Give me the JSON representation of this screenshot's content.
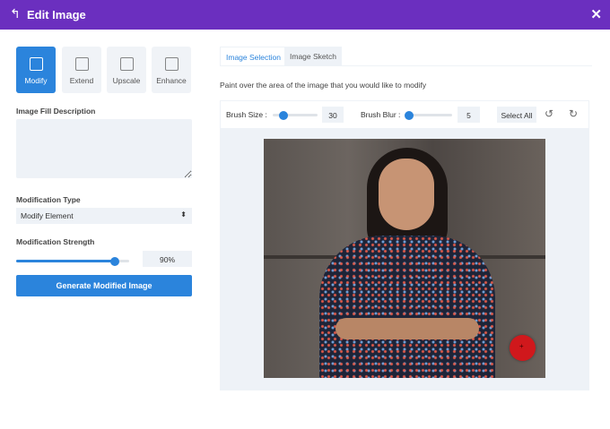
{
  "header": {
    "title": "Edit Image",
    "back_icon": "undo-arrow-icon",
    "close_icon": "close-icon"
  },
  "modes": [
    {
      "label": "Modify",
      "active": true
    },
    {
      "label": "Extend"
    },
    {
      "label": "Upscale"
    },
    {
      "label": "Enhance"
    }
  ],
  "fill_description": {
    "label": "Image Fill Description",
    "value": ""
  },
  "modification_type": {
    "label": "Modification Type",
    "value": "Modify Element"
  },
  "modification_strength": {
    "label": "Modification Strength",
    "value": "90%",
    "fraction": 0.9
  },
  "generate_label": "Generate Modified Image",
  "tabs": [
    {
      "label": "Image Selection",
      "active": true
    },
    {
      "label": "Image Sketch"
    }
  ],
  "instruction": "Paint over the area of the image that you would like to modify",
  "toolbar": {
    "brush_size_label": "Brush Size :",
    "brush_size": "30",
    "brush_blur_label": "Brush Blur :",
    "brush_blur": "5",
    "select_all": "Select All"
  },
  "colors": {
    "header": "#6b2fbf",
    "accent": "#2b84dc",
    "brush": "#d0181c"
  }
}
